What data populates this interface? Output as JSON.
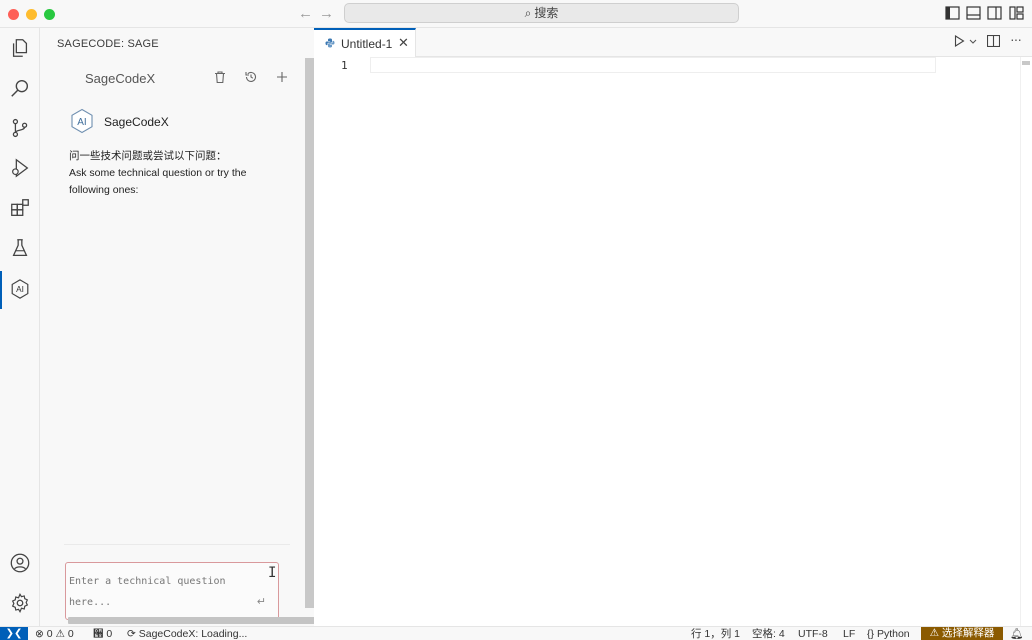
{
  "titlebar": {
    "search_text": "搜索"
  },
  "activity_bar": {
    "items": [
      "explorer",
      "search",
      "source-control",
      "run-and-debug",
      "extensions",
      "testing",
      "sagecode"
    ],
    "bottom_items": [
      "accounts",
      "manage"
    ],
    "active": "sagecode"
  },
  "sidebar": {
    "title": "SAGECODE: SAGE",
    "chat_header_title": "SageCodeX",
    "agent_name": "SageCodeX",
    "agent_icon_text": "AI",
    "prompt_lines": [
      "问一些技术问题或尝试以下问题：",
      "Ask some technical question or try the",
      "following ones:"
    ],
    "input_placeholder": "Enter a technical question here..."
  },
  "editor": {
    "tab_label": "Untitled-1",
    "line_numbers": [
      "1"
    ]
  },
  "statusbar": {
    "errors": "0",
    "warnings": "0",
    "ports": "0",
    "sagecode_status": "SageCodeX: Loading...",
    "cursor_position": "行 1，列 1",
    "indentation": "空格: 4",
    "encoding": "UTF-8",
    "eol": "LF",
    "language": "Python",
    "interpreter": "选择解释器"
  },
  "colors": {
    "accent": "#005fb8",
    "interpreter_warning_bg": "#8b5a00",
    "input_border": "#d9999c"
  }
}
